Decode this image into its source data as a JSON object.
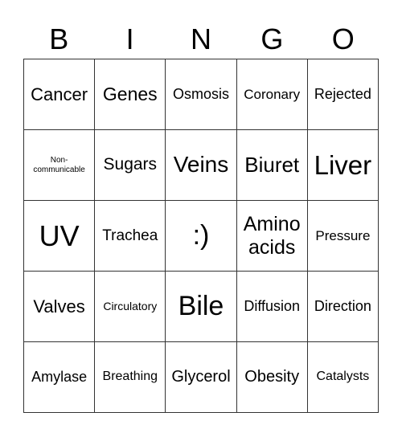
{
  "header": [
    "B",
    "I",
    "N",
    "G",
    "O"
  ],
  "cells": [
    {
      "text": "Cancer",
      "size": 22
    },
    {
      "text": "Genes",
      "size": 23
    },
    {
      "text": "Osmosis",
      "size": 18
    },
    {
      "text": "Coronary",
      "size": 17
    },
    {
      "text": "Rejected",
      "size": 18
    },
    {
      "text": "Non-communicable",
      "size": 10
    },
    {
      "text": "Sugars",
      "size": 21
    },
    {
      "text": "Veins",
      "size": 28
    },
    {
      "text": "Biuret",
      "size": 26
    },
    {
      "text": "Liver",
      "size": 33
    },
    {
      "text": "UV",
      "size": 36
    },
    {
      "text": "Trachea",
      "size": 19
    },
    {
      "text": ":)",
      "size": 34
    },
    {
      "text": "Amino acids",
      "size": 25
    },
    {
      "text": "Pressure",
      "size": 17
    },
    {
      "text": "Valves",
      "size": 22
    },
    {
      "text": "Circulatory",
      "size": 14
    },
    {
      "text": "Bile",
      "size": 34
    },
    {
      "text": "Diffusion",
      "size": 18
    },
    {
      "text": "Direction",
      "size": 18
    },
    {
      "text": "Amylase",
      "size": 18
    },
    {
      "text": "Breathing",
      "size": 16
    },
    {
      "text": "Glycerol",
      "size": 20
    },
    {
      "text": "Obesity",
      "size": 20
    },
    {
      "text": "Catalysts",
      "size": 16
    }
  ]
}
